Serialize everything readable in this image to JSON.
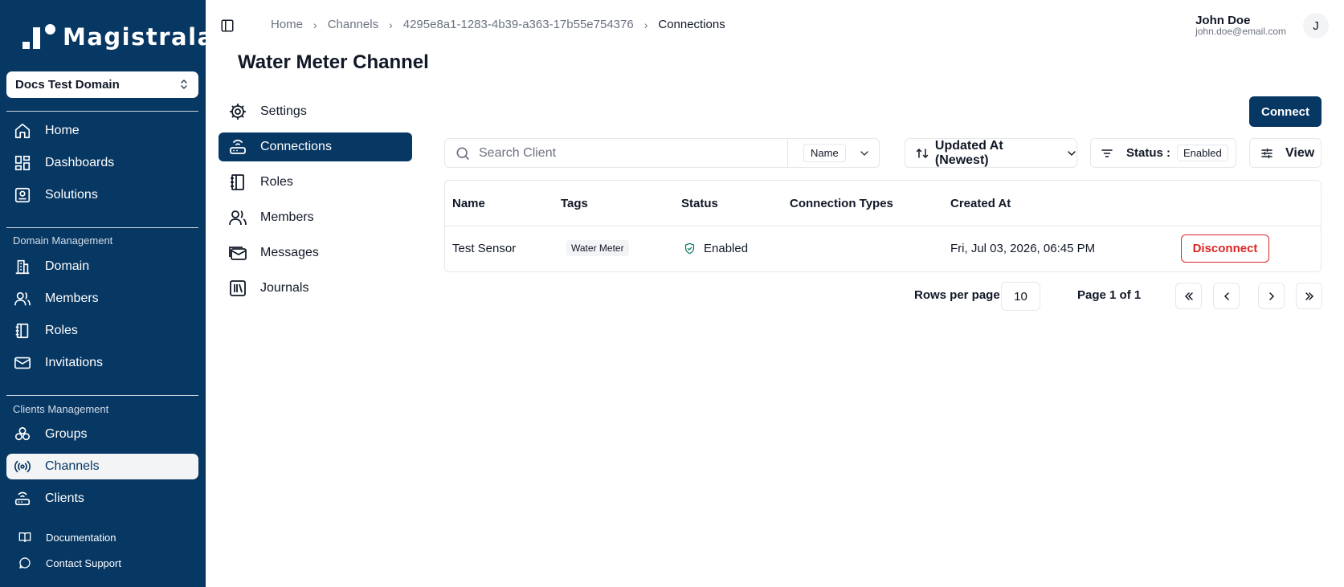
{
  "app": {
    "name": "Magistrala"
  },
  "domain_select": {
    "value": "Docs Test Domain"
  },
  "sidebar": {
    "main_items": [
      {
        "label": "Home",
        "icon": "home-icon"
      },
      {
        "label": "Dashboards",
        "icon": "dashboard-icon"
      },
      {
        "label": "Solutions",
        "icon": "solutions-icon"
      }
    ],
    "domain_group_label": "Domain Management",
    "domain_items": [
      {
        "label": "Domain",
        "icon": "building-icon"
      },
      {
        "label": "Members",
        "icon": "users-icon"
      },
      {
        "label": "Roles",
        "icon": "notebook-icon"
      },
      {
        "label": "Invitations",
        "icon": "mail-icon"
      }
    ],
    "clients_group_label": "Clients Management",
    "clients_items": [
      {
        "label": "Groups",
        "icon": "groups-icon"
      },
      {
        "label": "Channels",
        "icon": "radio-icon",
        "active": true
      },
      {
        "label": "Clients",
        "icon": "router-icon"
      }
    ],
    "footer_items": [
      {
        "label": "Documentation",
        "icon": "book-icon"
      },
      {
        "label": "Contact Support",
        "icon": "chat-icon"
      }
    ]
  },
  "breadcrumb": {
    "items": [
      "Home",
      "Channels",
      "4295e8a1-1283-4b39-a363-17b55e754376"
    ],
    "current": "Connections"
  },
  "user": {
    "name": "John Doe",
    "email": "john.doe@email.com",
    "initial": "J"
  },
  "page": {
    "title": "Water Meter Channel"
  },
  "subnav": {
    "items": [
      {
        "label": "Settings",
        "icon": "gear-icon"
      },
      {
        "label": "Connections",
        "icon": "router-icon",
        "active": true
      },
      {
        "label": "Roles",
        "icon": "notebook-icon"
      },
      {
        "label": "Members",
        "icon": "users-icon"
      },
      {
        "label": "Messages",
        "icon": "mail-icon"
      },
      {
        "label": "Journals",
        "icon": "library-icon"
      }
    ]
  },
  "toolbar": {
    "connect_label": "Connect",
    "search_placeholder": "Search Client",
    "search_field": "Name",
    "sort_label": "Updated At (Newest)",
    "status_label": "Status :",
    "status_value": "Enabled",
    "view_label": "View"
  },
  "table": {
    "columns": [
      "Name",
      "Tags",
      "Status",
      "Connection Types",
      "Created At"
    ],
    "rows": [
      {
        "name": "Test Sensor",
        "tag": "Water Meter",
        "status": "Enabled",
        "connection_types": "",
        "created_at": "Fri, Jul 03, 2026, 06:45 PM",
        "action": "Disconnect"
      }
    ]
  },
  "pagination": {
    "rows_per_page_label": "Rows per page",
    "rows_per_page": "10",
    "page_label": "Page 1 of 1"
  },
  "colors": {
    "brand": "#073763",
    "danger": "#dc2626",
    "success": "#0f766e"
  }
}
